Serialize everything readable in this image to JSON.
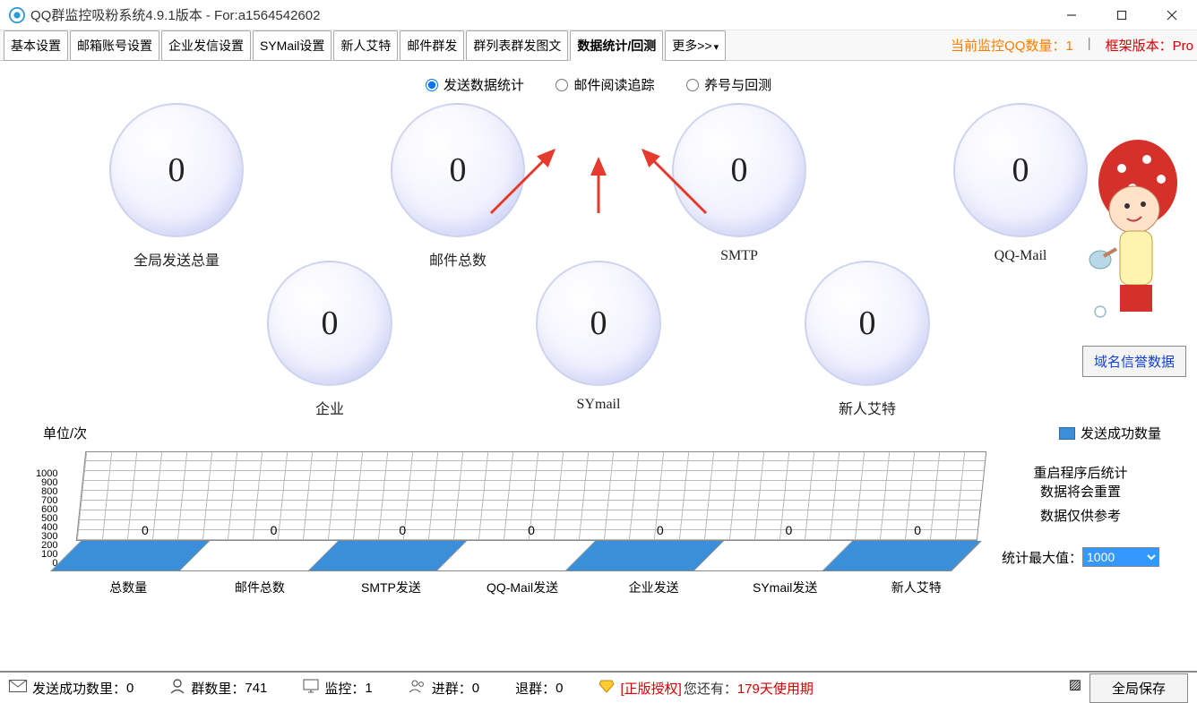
{
  "window": {
    "title": "QQ群监控吸粉系统4.9.1版本 - For:a1564542602"
  },
  "tabs": {
    "items": [
      "基本设置",
      "邮箱账号设置",
      "企业发信设置",
      "SYMail设置",
      "新人艾特",
      "邮件群发",
      "群列表群发图文",
      "数据统计/回测"
    ],
    "more": "更多>>"
  },
  "status_bar": {
    "monitor_label_a": "当前监控QQ数量：",
    "monitor_val": "1",
    "frame_label_a": "框架版本：",
    "frame_val": "Pro"
  },
  "radios": {
    "r1": "发送数据统计",
    "r2": "邮件阅读追踪",
    "r3": "养号与回测"
  },
  "bubbles_top": [
    {
      "value": "0",
      "label": "全局发送总量"
    },
    {
      "value": "0",
      "label": "邮件总数"
    },
    {
      "value": "0",
      "label": "SMTP"
    },
    {
      "value": "0",
      "label": "QQ-Mail"
    }
  ],
  "bubbles_bottom": [
    {
      "value": "0",
      "label": "企业"
    },
    {
      "value": "0",
      "label": "SYmail"
    },
    {
      "value": "0",
      "label": "新人艾特"
    }
  ],
  "domain_btn": "域名信誉数据",
  "chart": {
    "unit": "单位/次",
    "legend": "发送成功数量",
    "note1a": "重启程序后统计",
    "note1b": "数据将会重置",
    "note2": "数据仅供参考",
    "max_label": "统计最大值：",
    "max_value": "1000",
    "y_ticks": [
      "1000",
      "900",
      "800",
      "700",
      "600",
      "500",
      "400",
      "300",
      "200",
      "100",
      "0"
    ]
  },
  "chart_data": {
    "type": "bar",
    "categories": [
      "总数量",
      "邮件总数",
      "SMTP发送",
      "QQ-Mail发送",
      "企业发送",
      "SYmail发送",
      "新人艾特"
    ],
    "values": [
      0,
      0,
      0,
      0,
      0,
      0,
      0
    ],
    "title": "",
    "xlabel": "",
    "ylabel": "单位/次",
    "ylim": [
      0,
      1000
    ]
  },
  "footer": {
    "sent_label": "发送成功数里：",
    "sent_val": "0",
    "groups_label": "群数里：",
    "groups_val": "741",
    "monitor_label": "监控：",
    "monitor_val": "1",
    "join_label": "进群：",
    "join_val": "0",
    "leave_label": "退群：",
    "leave_val": "0",
    "auth_pre": "[正版授权]",
    "auth_mid": "您还有：",
    "auth_days": "179天使用期",
    "save": "全局保存"
  }
}
